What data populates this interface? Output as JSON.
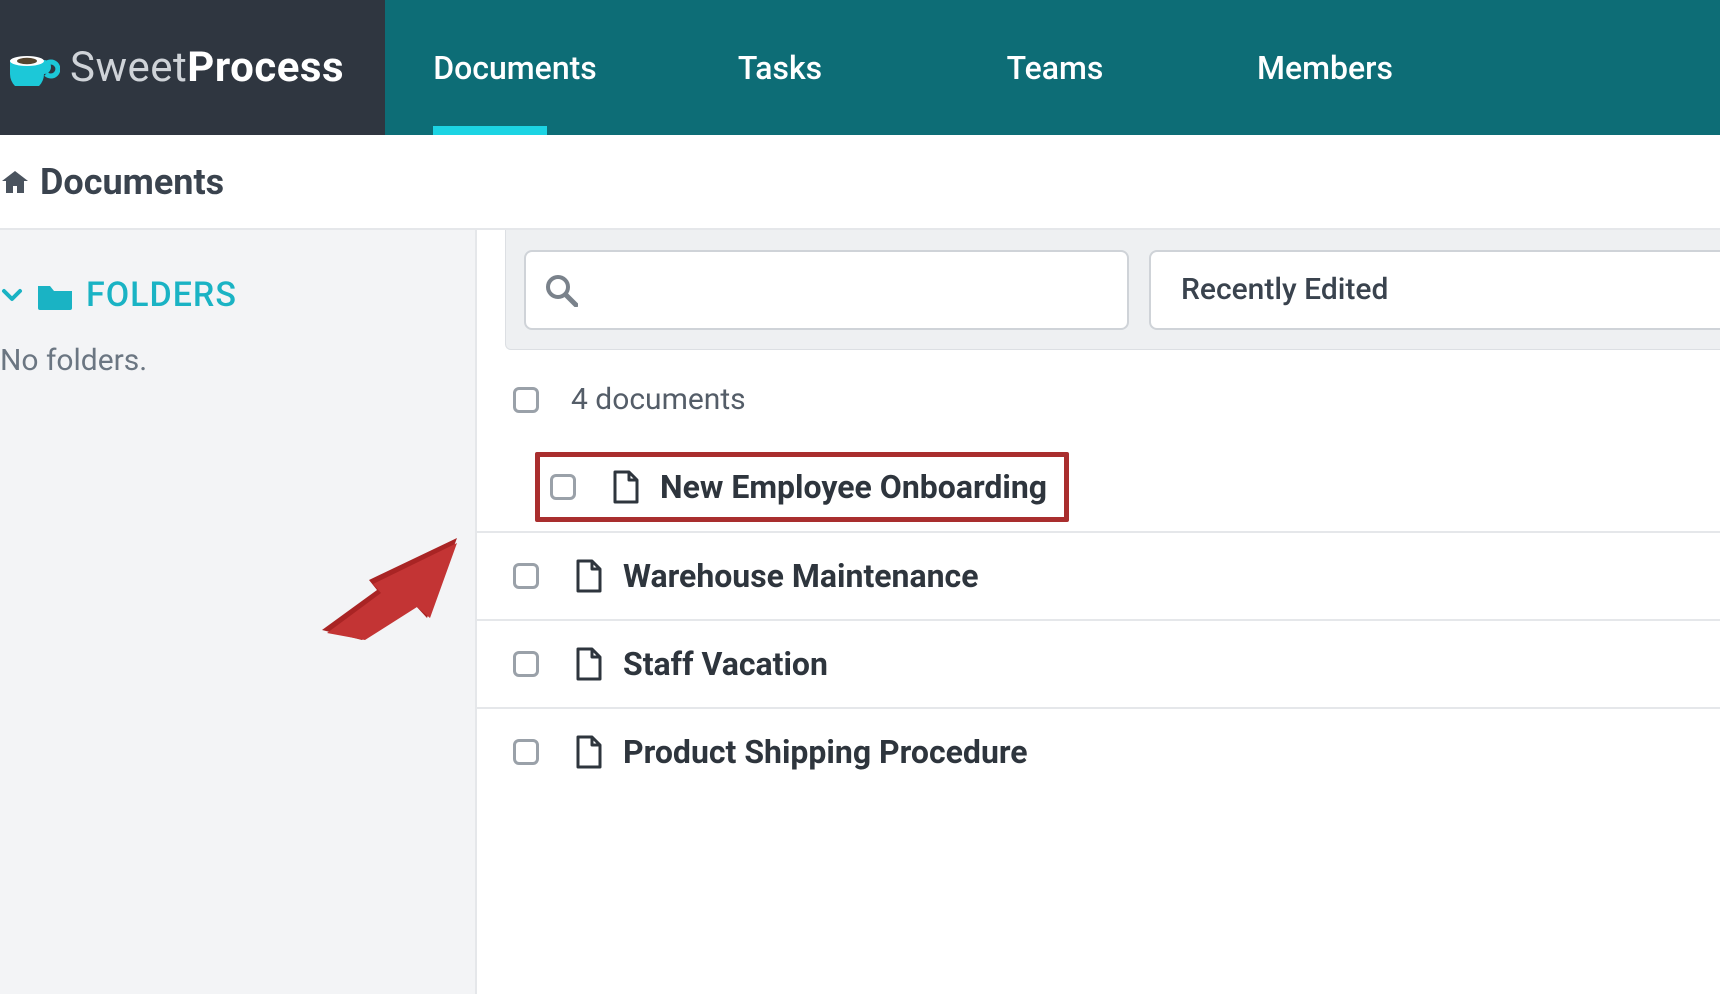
{
  "brand": {
    "name_light": "Sweet",
    "name_bold": "Process"
  },
  "nav": {
    "documents": "Documents",
    "tasks": "Tasks",
    "teams": "Teams",
    "members": "Members"
  },
  "breadcrumb": {
    "title": "Documents"
  },
  "sidebar": {
    "folders_label": "FOLDERS",
    "empty_text": "No folders."
  },
  "toolbar": {
    "sort_label": "Recently Edited"
  },
  "count": {
    "text": "4 documents"
  },
  "docs": [
    {
      "title": "New Employee Onboarding"
    },
    {
      "title": "Warehouse Maintenance"
    },
    {
      "title": "Staff Vacation"
    },
    {
      "title": "Product Shipping Procedure"
    }
  ]
}
